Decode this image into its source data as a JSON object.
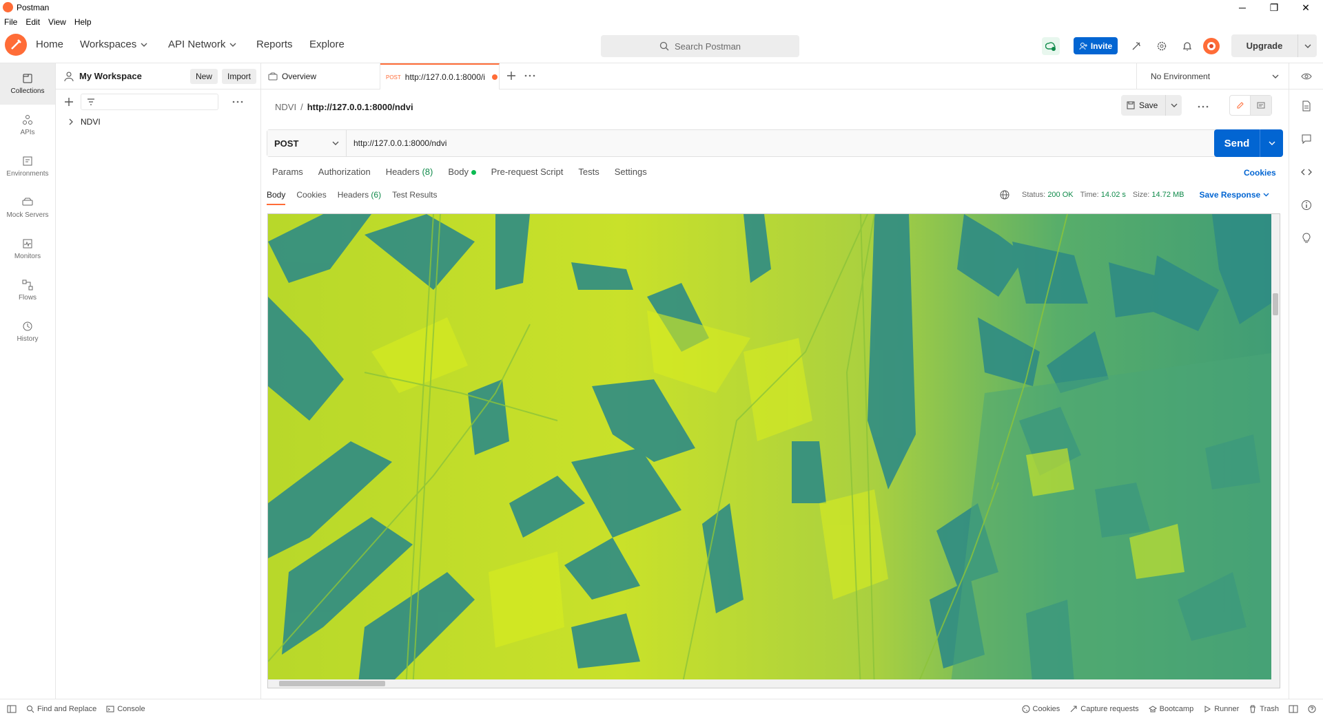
{
  "window": {
    "title": "Postman",
    "minimize": "─",
    "maximize": "❐",
    "close": "✕"
  },
  "menu": [
    "File",
    "Edit",
    "View",
    "Help"
  ],
  "nav": {
    "home": "Home",
    "workspaces": "Workspaces",
    "api_network": "API Network",
    "reports": "Reports",
    "explore": "Explore",
    "search_placeholder": "Search Postman",
    "invite": "Invite",
    "upgrade": "Upgrade"
  },
  "sidebar": {
    "items": [
      {
        "label": "Collections",
        "icon": "collections-icon"
      },
      {
        "label": "APIs",
        "icon": "apis-icon"
      },
      {
        "label": "Environments",
        "icon": "environments-icon"
      },
      {
        "label": "Mock Servers",
        "icon": "mock-servers-icon"
      },
      {
        "label": "Monitors",
        "icon": "monitors-icon"
      },
      {
        "label": "Flows",
        "icon": "flows-icon"
      },
      {
        "label": "History",
        "icon": "history-icon"
      }
    ]
  },
  "workspace": {
    "name": "My Workspace",
    "new_label": "New",
    "import_label": "Import",
    "collection": "NDVI"
  },
  "tabs": {
    "overview": "Overview",
    "request_method": "POST",
    "request_url": "http://127.0.0.1:8000/i",
    "environment": "No Environment"
  },
  "request": {
    "breadcrumb_parent": "NDVI",
    "breadcrumb_sep": "/",
    "breadcrumb_current": "http://127.0.0.1:8000/ndvi",
    "save_label": "Save",
    "method": "POST",
    "url": "http://127.0.0.1:8000/ndvi",
    "send_label": "Send",
    "tabs": {
      "params": "Params",
      "authorization": "Authorization",
      "headers": "Headers",
      "headers_count": "(8)",
      "body": "Body",
      "pre_request": "Pre-request Script",
      "tests": "Tests",
      "settings": "Settings",
      "cookies": "Cookies"
    }
  },
  "response": {
    "tabs": {
      "body": "Body",
      "cookies": "Cookies",
      "headers": "Headers",
      "headers_count": "(6)",
      "test_results": "Test Results"
    },
    "status_label": "Status:",
    "status_value": "200 OK",
    "time_label": "Time:",
    "time_value": "14.02 s",
    "size_label": "Size:",
    "size_value": "14.72 MB",
    "save_response": "Save Response"
  },
  "statusbar": {
    "find_replace": "Find and Replace",
    "console": "Console",
    "cookies": "Cookies",
    "capture": "Capture requests",
    "bootcamp": "Bootcamp",
    "runner": "Runner",
    "trash": "Trash"
  },
  "colors": {
    "brand": "#ff6c37",
    "primary": "#0265d2",
    "success": "#0f8a4a",
    "ndvi_dark": "#2e8a86",
    "ndvi_light": "#d4e81a"
  }
}
